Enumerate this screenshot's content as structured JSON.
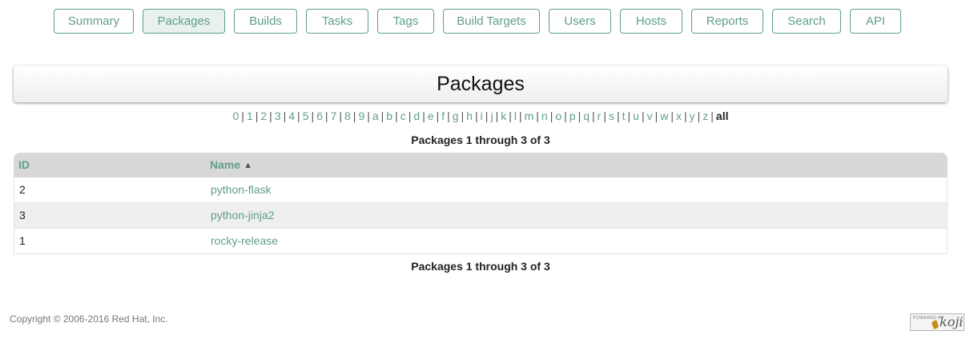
{
  "nav": {
    "tabs": [
      {
        "label": "Summary",
        "active": false
      },
      {
        "label": "Packages",
        "active": true
      },
      {
        "label": "Builds",
        "active": false
      },
      {
        "label": "Tasks",
        "active": false
      },
      {
        "label": "Tags",
        "active": false
      },
      {
        "label": "Build Targets",
        "active": false
      },
      {
        "label": "Users",
        "active": false
      },
      {
        "label": "Hosts",
        "active": false
      },
      {
        "label": "Reports",
        "active": false
      },
      {
        "label": "Search",
        "active": false
      },
      {
        "label": "API",
        "active": false
      }
    ]
  },
  "header": {
    "title": "Packages"
  },
  "letters": {
    "items": [
      "0",
      "1",
      "2",
      "3",
      "4",
      "5",
      "6",
      "7",
      "8",
      "9",
      "a",
      "b",
      "c",
      "d",
      "e",
      "f",
      "g",
      "h",
      "i",
      "j",
      "k",
      "l",
      "m",
      "n",
      "o",
      "p",
      "q",
      "r",
      "s",
      "t",
      "u",
      "v",
      "w",
      "x",
      "y",
      "z",
      "all"
    ],
    "current": "all",
    "separator": "|"
  },
  "pagination": {
    "top_label": "Packages 1 through 3 of 3",
    "bottom_label": "Packages 1 through 3 of 3"
  },
  "table": {
    "columns": {
      "id": "ID",
      "name": "Name"
    },
    "sort_icon": "▲",
    "rows": [
      {
        "id": "2",
        "name": "python-flask"
      },
      {
        "id": "3",
        "name": "python-jinja2"
      },
      {
        "id": "1",
        "name": "rocky-release"
      }
    ]
  },
  "footer": {
    "copyright": "Copyright © 2006-2016 Red Hat, Inc.",
    "powered_by_text": "POWERED BY",
    "powered_by_logo": "koji"
  },
  "colors": {
    "accent": "#5f9f86",
    "header_row": "#d8d8d8",
    "stripe": "#efefef"
  }
}
